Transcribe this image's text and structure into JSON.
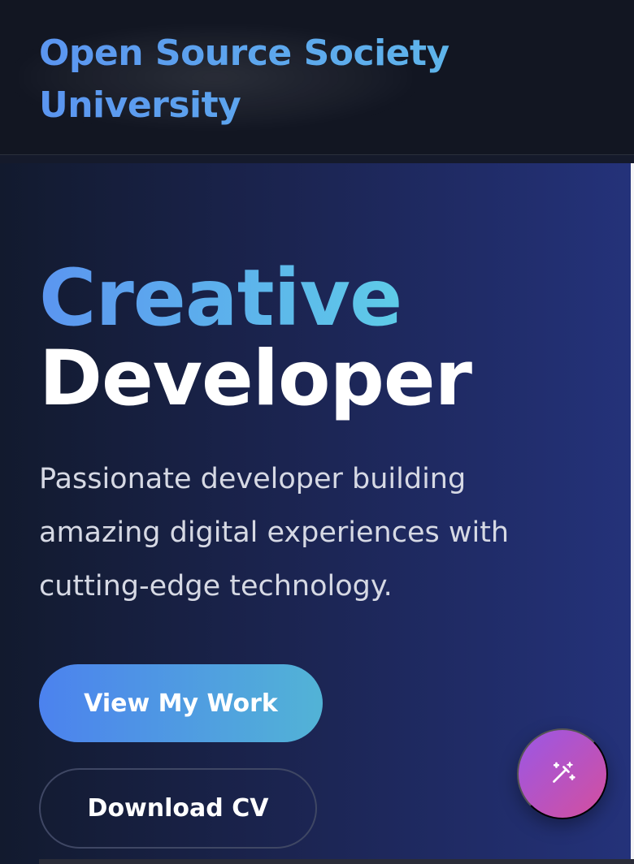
{
  "header": {
    "brand": "Open Source Society University"
  },
  "hero": {
    "title_accent": "Creative",
    "title_main": "Developer",
    "subtitle": "Passionate developer building amazing digital experiences with cutting-edge technology.",
    "primary_button": "View My Work",
    "secondary_button": "Download CV"
  },
  "fab": {
    "icon": "magic-wand-icon"
  },
  "colors": {
    "accent_blue": "#5b95f0",
    "accent_cyan": "#5ecbe8",
    "fab_purple": "#9a57e6",
    "fab_pink": "#d44f9e"
  }
}
